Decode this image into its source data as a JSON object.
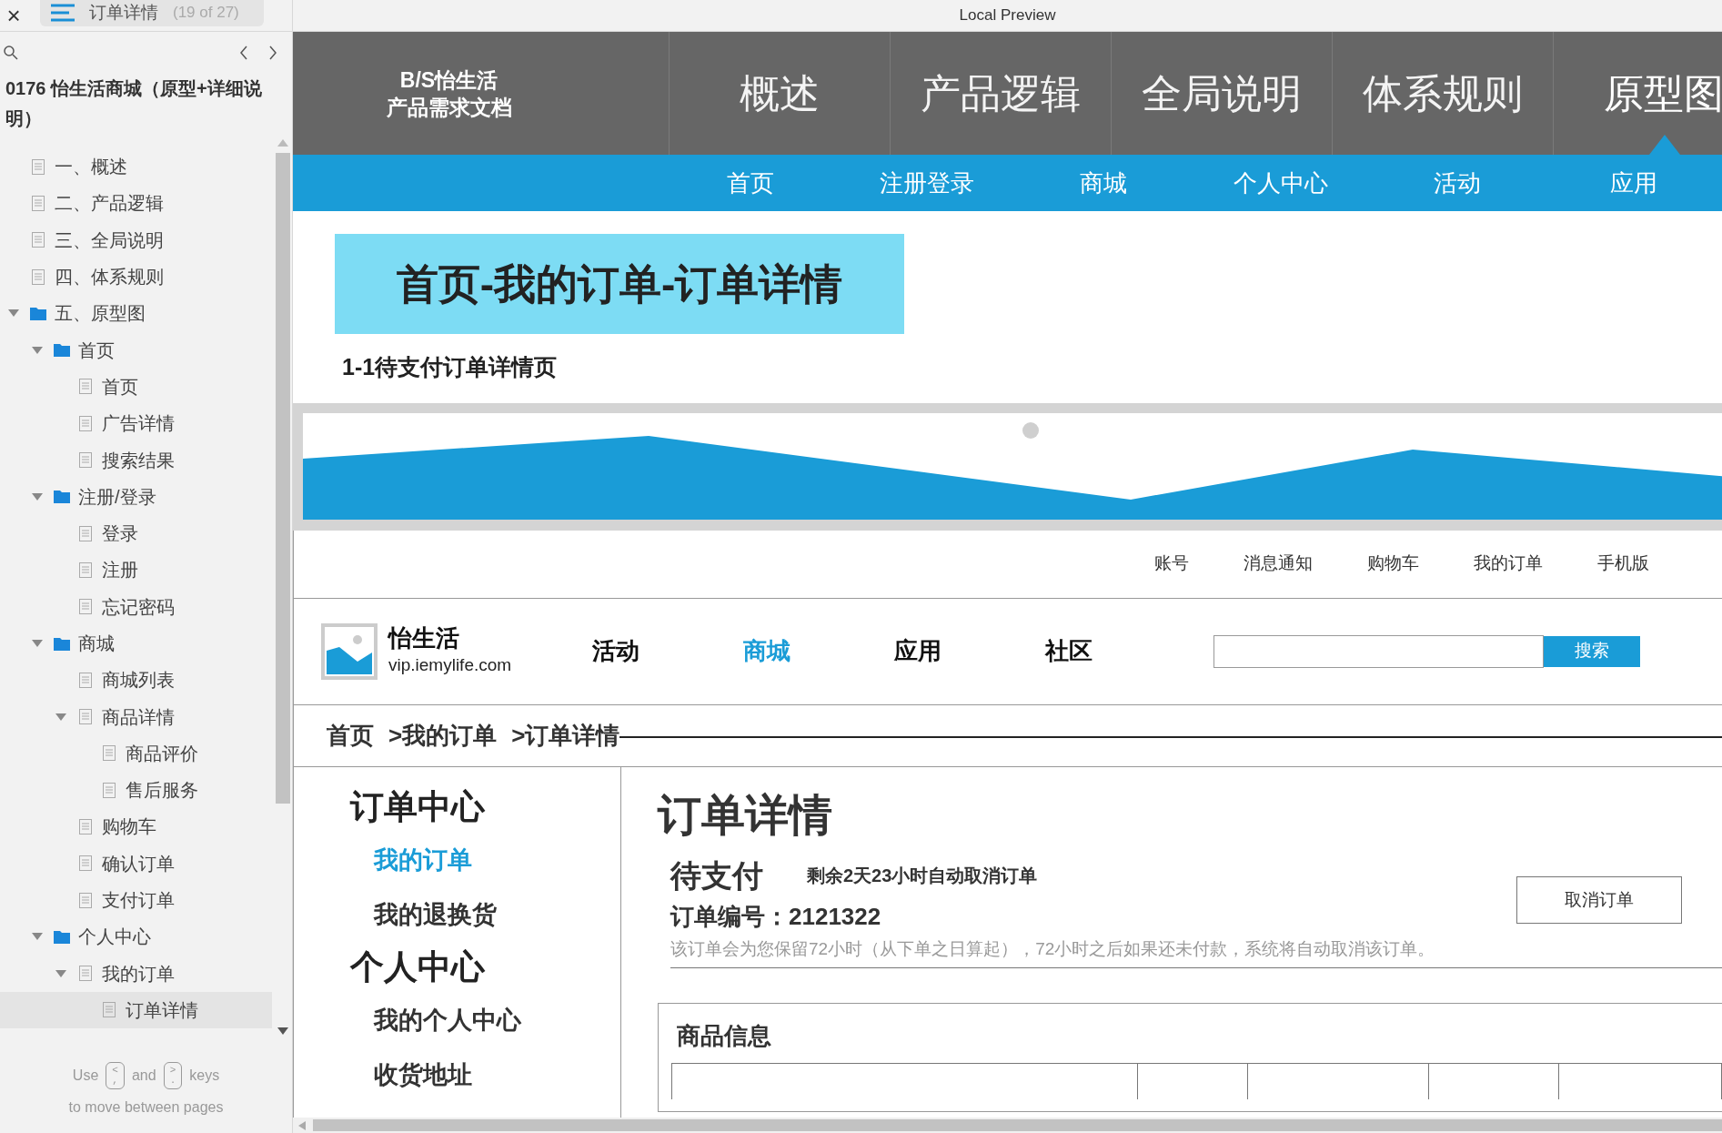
{
  "viewer": {
    "close": "×",
    "page_title": "订单详情",
    "page_count": "(19 of 27)",
    "window_title": "Local Preview"
  },
  "sidebar": {
    "project_title": "0176 怡生活商城（原型+详细说明）",
    "tree": [
      {
        "label": "一、概述",
        "kind": "page",
        "selected": false
      },
      {
        "label": "二、产品逻辑",
        "kind": "page",
        "selected": false
      },
      {
        "label": "三、全局说明",
        "kind": "page",
        "selected": false
      },
      {
        "label": "四、体系规则",
        "kind": "page",
        "selected": false
      },
      {
        "label": "五、原型图",
        "kind": "folder",
        "selected": false,
        "expanded": true,
        "children": [
          {
            "label": "首页",
            "kind": "folder",
            "selected": false,
            "expanded": true,
            "children": [
              {
                "label": "首页",
                "kind": "page",
                "selected": false
              },
              {
                "label": "广告详情",
                "kind": "page",
                "selected": false
              },
              {
                "label": "搜索结果",
                "kind": "page",
                "selected": false
              }
            ]
          },
          {
            "label": "注册/登录",
            "kind": "folder",
            "selected": false,
            "expanded": true,
            "children": [
              {
                "label": "登录",
                "kind": "page",
                "selected": false
              },
              {
                "label": "注册",
                "kind": "page",
                "selected": false
              },
              {
                "label": "忘记密码",
                "kind": "page",
                "selected": false
              }
            ]
          },
          {
            "label": "商城",
            "kind": "folder",
            "selected": false,
            "expanded": true,
            "children": [
              {
                "label": "商城列表",
                "kind": "page",
                "selected": false
              },
              {
                "label": "商品详情",
                "kind": "page",
                "selected": false,
                "expanded": true,
                "children": [
                  {
                    "label": "商品评价",
                    "kind": "page",
                    "selected": false
                  },
                  {
                    "label": "售后服务",
                    "kind": "page",
                    "selected": false
                  }
                ]
              },
              {
                "label": "购物车",
                "kind": "page",
                "selected": false
              },
              {
                "label": "确认订单",
                "kind": "page",
                "selected": false
              },
              {
                "label": "支付订单",
                "kind": "page",
                "selected": false
              }
            ]
          },
          {
            "label": "个人中心",
            "kind": "folder",
            "selected": false,
            "expanded": true,
            "children": [
              {
                "label": "我的订单",
                "kind": "page",
                "selected": false,
                "expanded": true,
                "children": [
                  {
                    "label": "订单详情",
                    "kind": "page",
                    "selected": true
                  }
                ]
              }
            ]
          }
        ]
      }
    ],
    "hint": {
      "use": "Use",
      "key_prev": "<\n,",
      "and": "and",
      "key_next": ">\n.",
      "keys": "keys",
      "line2": "to move between pages"
    }
  },
  "doc_header": {
    "logo_lines": [
      "B/S怡生活",
      "产品需求文档"
    ],
    "tabs": [
      {
        "label": "概述",
        "selected": false
      },
      {
        "label": "产品逻辑",
        "selected": false
      },
      {
        "label": "全局说明",
        "selected": false
      },
      {
        "label": "体系规则",
        "selected": false
      },
      {
        "label": "原型图",
        "selected": true
      }
    ],
    "subnav": [
      "首页",
      "注册登录",
      "商城",
      "个人中心",
      "活动",
      "应用"
    ]
  },
  "banner": {
    "title": "首页-我的订单-订单详情",
    "subtitle": "1-1待支付订单详情页"
  },
  "site": {
    "top_links": [
      "账号",
      "消息通知",
      "购物车",
      "我的订单",
      "手机版"
    ],
    "brand": {
      "name": "怡生活",
      "url": "vip.iemylife.com"
    },
    "nav": [
      {
        "label": "活动",
        "selected": false
      },
      {
        "label": "商城",
        "selected": true
      },
      {
        "label": "应用",
        "selected": false
      },
      {
        "label": "社区",
        "selected": false
      }
    ],
    "search_button": "搜索",
    "breadcrumb": [
      "首页",
      ">我的订单",
      ">订单详情"
    ],
    "side_menu": [
      {
        "kind": "heading",
        "label": "订单中心",
        "selected": false
      },
      {
        "kind": "item",
        "label": "我的订单",
        "selected": true
      },
      {
        "kind": "item",
        "label": "我的退换货",
        "selected": false
      },
      {
        "kind": "heading",
        "label": "个人中心",
        "selected": false
      },
      {
        "kind": "item",
        "label": "我的个人中心",
        "selected": false
      },
      {
        "kind": "item",
        "label": "收货地址",
        "selected": false
      }
    ],
    "order": {
      "title": "订单详情",
      "status": "待支付",
      "countdown": "剩余2天23小时自动取消订单",
      "number_label": "订单编号：",
      "number": "2121322",
      "cancel_button": "取消订单",
      "note": "该订单会为您保留72小时（从下单之日算起），72小时之后如果还未付款，系统将自动取消该订单。",
      "section_title": "商品信息"
    }
  }
}
